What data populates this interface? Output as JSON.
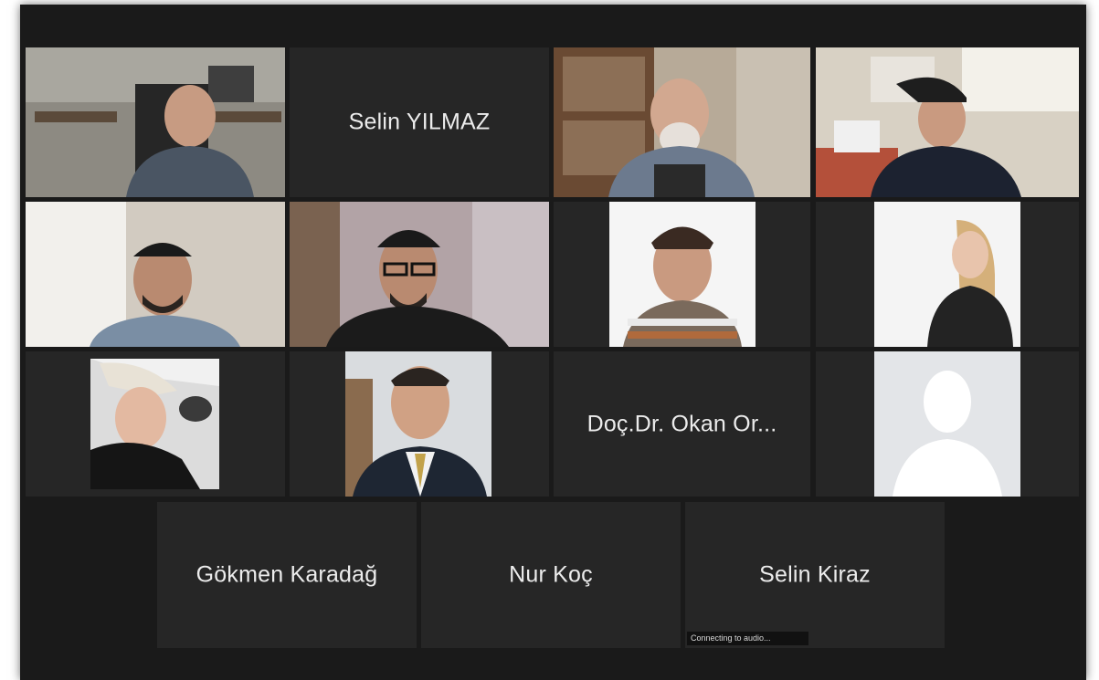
{
  "participants": {
    "selin_yilmaz": "Selin YILMAZ",
    "okan": "Doç.Dr. Okan Or...",
    "gokmen": "Gökmen Karadağ",
    "nur": "Nur Koç",
    "selin_kiraz": "Selin Kiraz"
  },
  "status": {
    "connecting": "Connecting to audio..."
  },
  "colors": {
    "background": "#1a1a1a",
    "tile": "#262626",
    "active_speaker_border": "#d9d97a",
    "name_text": "#ececec"
  }
}
